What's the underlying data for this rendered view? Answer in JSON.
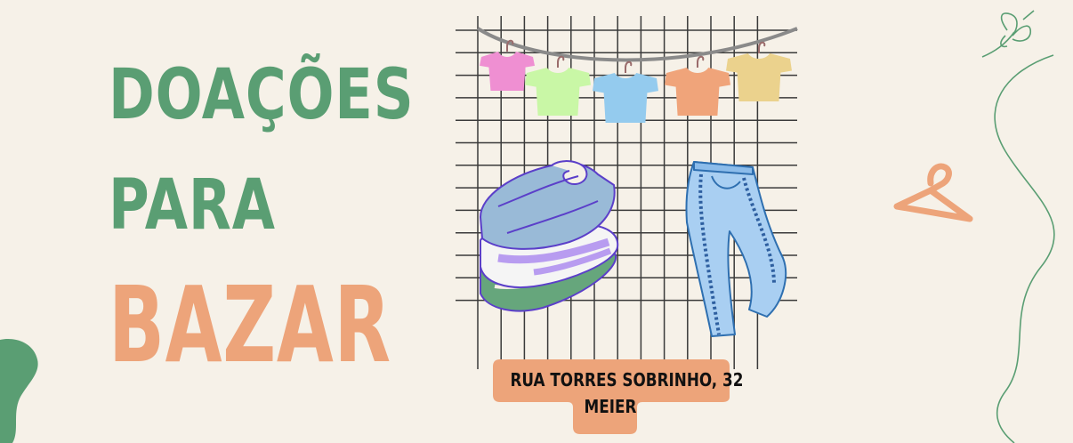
{
  "headline": {
    "line1": "DOAÇÕES",
    "line2": "PARA",
    "line3": "BAZAR"
  },
  "address": {
    "street": "RUA TORRES SOBRINHO, 32",
    "district": "MEIER"
  },
  "colors": {
    "background": "#f6f1e8",
    "green": "#5a9e73",
    "orange": "#eda47a",
    "grid": "#3a3a3a",
    "shirt_pink": "#ef8fd2",
    "shirt_lime": "#c9f7a6",
    "shirt_blue": "#94cbee",
    "shirt_orange": "#f0a47a",
    "shirt_yellow": "#ebd28d",
    "jeans": "#a9cff2"
  },
  "icons": [
    "butterfly-icon",
    "hanger-icon",
    "tshirt-icon",
    "folded-sweaters-icon",
    "jeans-icon"
  ]
}
